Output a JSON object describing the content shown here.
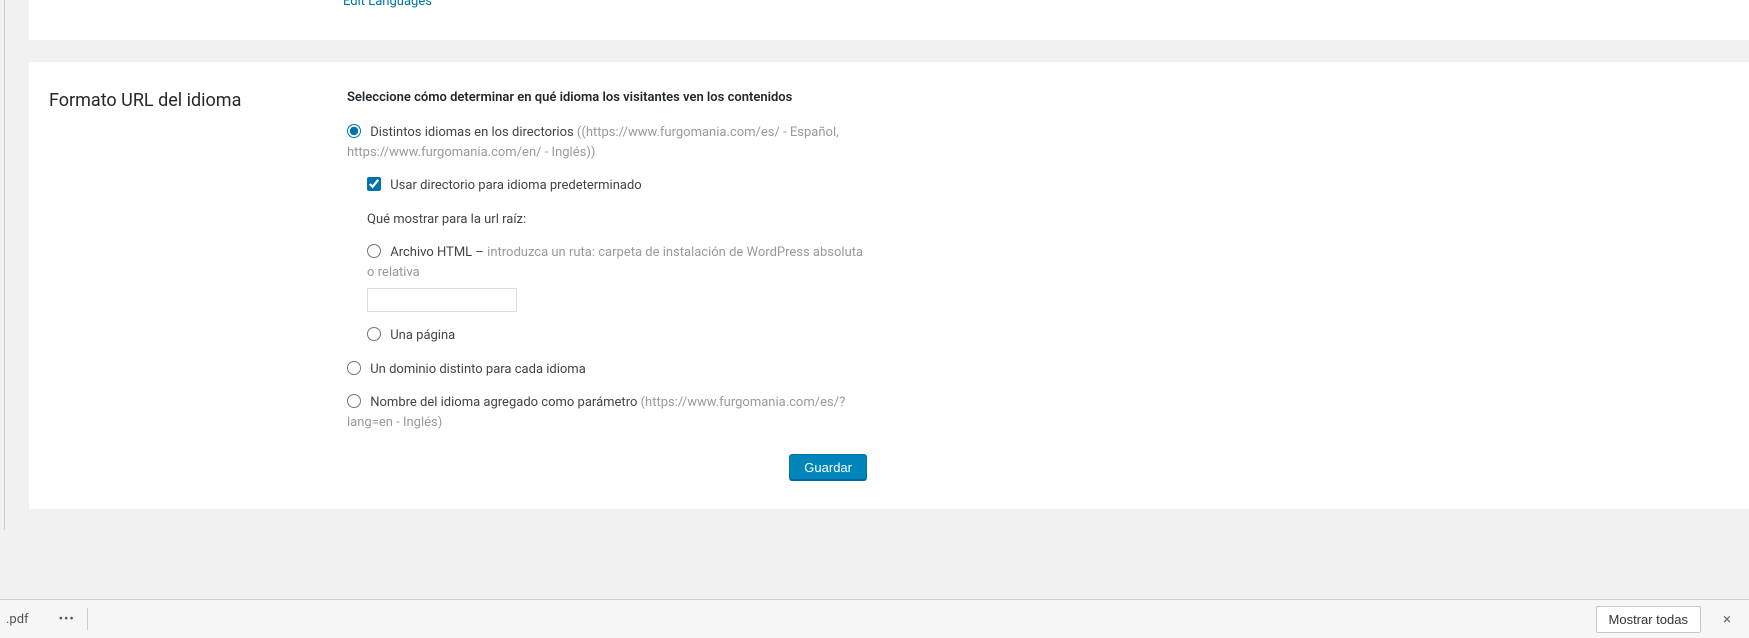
{
  "top": {
    "edit_languages": "Edit Languages"
  },
  "panel": {
    "title": "Formato URL del idioma",
    "subheading": "Seleccione cómo determinar en qué idioma los visitantes ven los contenidos",
    "opt1": {
      "label": "Distintos idiomas en los directorios ",
      "hint": "((https://www.furgomania.com/es/ - Español, https://www.furgomania.com/en/ - Inglés))",
      "use_dir_label": "Usar directorio para idioma predeterminado",
      "root_label": "Qué mostrar para la url raíz:",
      "html_label": "Archivo HTML – ",
      "html_hint": "introduzca un ruta: carpeta de instalación de WordPress absoluta o relativa",
      "page_label": "Una página"
    },
    "opt2": {
      "label": "Un dominio distinto para cada idioma"
    },
    "opt3": {
      "label": "Nombre del idioma agregado como parámetro ",
      "hint": "(https://www.furgomania.com/es/?lang=en - Inglés)"
    },
    "save": "Guardar"
  },
  "download_bar": {
    "file": ".pdf",
    "more": "•••",
    "show_all": "Mostrar todas",
    "close": "×"
  }
}
